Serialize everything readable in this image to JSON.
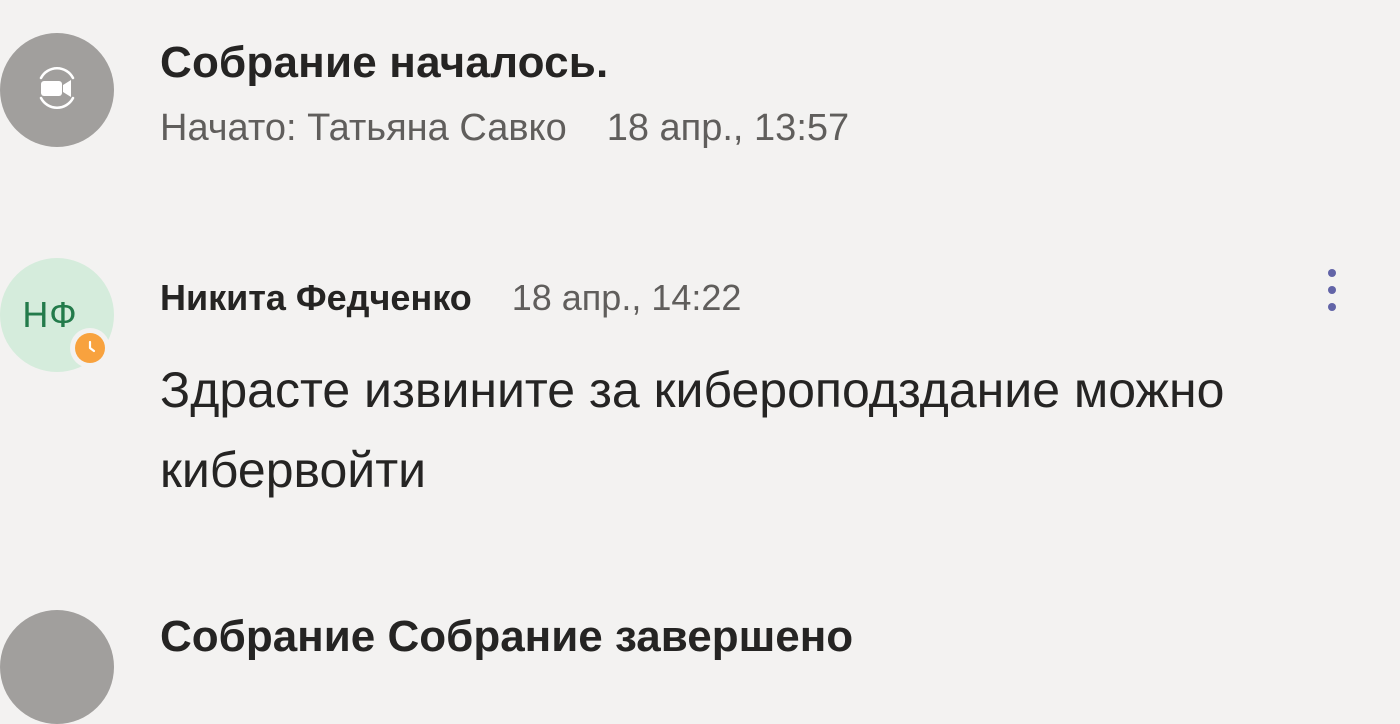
{
  "events": {
    "meeting_started": {
      "icon": "video-camera-icon",
      "title": "Собрание началось.",
      "started_by": "Начато: Татьяна Савко",
      "time": "18 апр., 13:57"
    },
    "meeting_ended": {
      "icon": "video-camera-icon",
      "title": "Собрание Собрание завершено"
    }
  },
  "message": {
    "initials": "НФ",
    "avatar_color": "#d5ecdc",
    "initials_color": "#237b4b",
    "presence": "away",
    "presence_color": "#f8a23e",
    "presence_icon": "clock-icon",
    "author": "Никита Федченко",
    "time": "18 апр., 14:22",
    "text": "Здрасте извините за кибероподздание можно кибервойти",
    "more_icon": "more-options-icon",
    "more_color": "#6264a7"
  },
  "colors": {
    "background": "#f3f2f1",
    "system_avatar": "#a19f9d",
    "text_primary": "#252423",
    "text_secondary": "#605e5c"
  }
}
